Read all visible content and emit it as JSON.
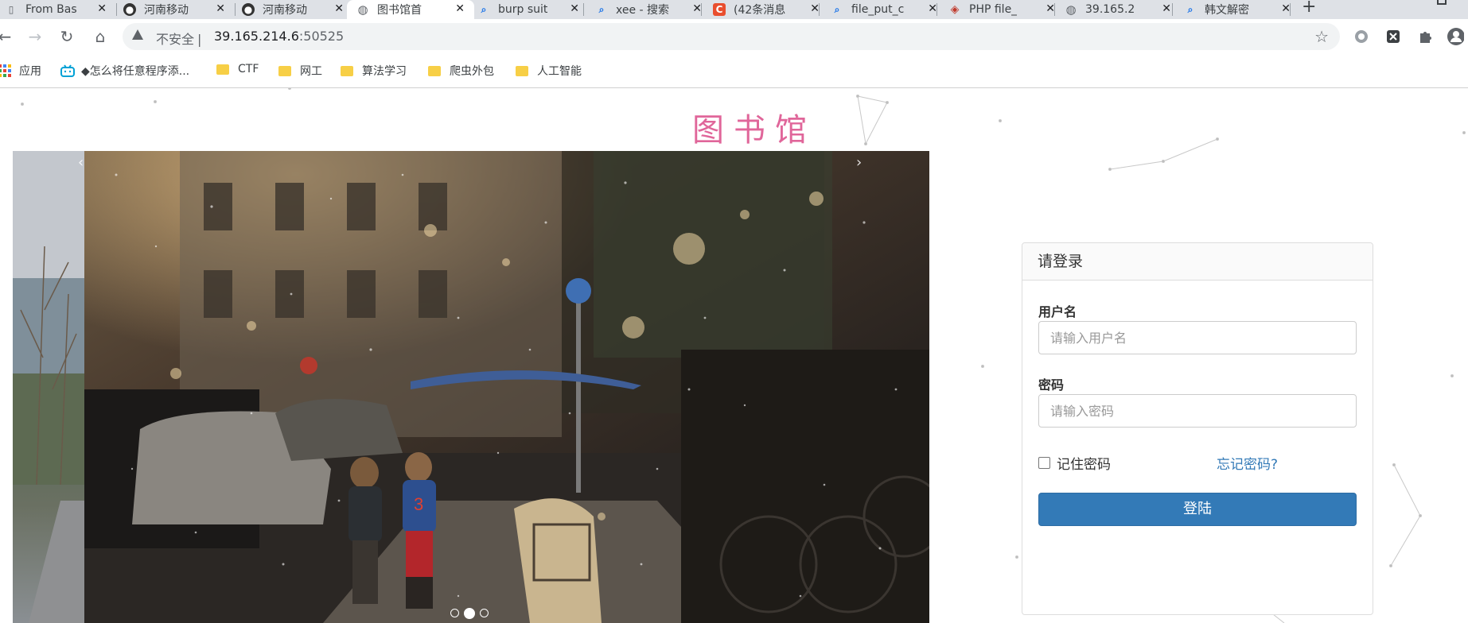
{
  "tabs": [
    {
      "title": "From Bas",
      "icon": "bookmark-icon",
      "active": false
    },
    {
      "title": "河南移动",
      "icon": "user-avatar-icon",
      "active": false
    },
    {
      "title": "河南移动",
      "icon": "user-avatar-icon",
      "active": false
    },
    {
      "title": "图书馆首",
      "icon": "globe-icon",
      "active": true
    },
    {
      "title": "burp suit",
      "icon": "search-icon",
      "active": false
    },
    {
      "title": "xee - 搜索",
      "icon": "search-icon",
      "active": false
    },
    {
      "title": "(42条消息",
      "icon": "csdn-icon",
      "active": false
    },
    {
      "title": "file_put_c",
      "icon": "search-icon",
      "active": false
    },
    {
      "title": "PHP file_",
      "icon": "php-runoob-icon",
      "active": false
    },
    {
      "title": "39.165.2",
      "icon": "globe-icon",
      "active": false
    },
    {
      "title": "韩文解密",
      "icon": "search-icon",
      "active": false
    }
  ],
  "addressbar": {
    "security_label": "不安全",
    "separator": "|",
    "host": "39.165.214.6",
    "port": ":50525"
  },
  "bookmarks": [
    {
      "label": "应用",
      "icon": "apps-grid-icon"
    },
    {
      "label": "◆怎么将任意程序添...",
      "icon": "bilibili-icon"
    },
    {
      "label": "CTF",
      "icon": "folder-icon"
    },
    {
      "label": "网工",
      "icon": "folder-icon"
    },
    {
      "label": "算法学习",
      "icon": "folder-icon"
    },
    {
      "label": "爬虫外包",
      "icon": "folder-icon"
    },
    {
      "label": "人工智能",
      "icon": "folder-icon"
    }
  ],
  "page": {
    "title": "图书馆",
    "carousel": {
      "prev_symbol": "‹",
      "next_symbol": "›",
      "slide_count": 3,
      "active_slide": 2
    },
    "login": {
      "heading": "请登录",
      "username_label": "用户名",
      "username_placeholder": "请输入用户名",
      "password_label": "密码",
      "password_placeholder": "请输入密码",
      "remember_label": "记住密码",
      "forgot_label": "忘记密码?",
      "submit_label": "登陆"
    }
  },
  "colors": {
    "title": "#e0669a",
    "primary_button": "#337ab7",
    "link": "#337ab7",
    "tabbar": "#dee1e6"
  }
}
